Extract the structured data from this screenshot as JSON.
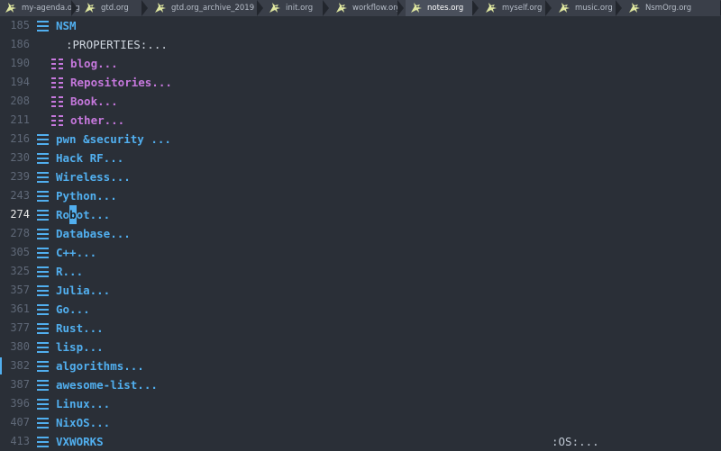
{
  "tabs": [
    {
      "label": "my-agenda.org",
      "active": false
    },
    {
      "label": "gtd.org",
      "active": false
    },
    {
      "label": "gtd.org_archive_2019",
      "active": false
    },
    {
      "label": "init.org",
      "active": false
    },
    {
      "label": "workflow.org",
      "active": false
    },
    {
      "label": "notes.org",
      "active": true
    },
    {
      "label": "myself.org",
      "active": false
    },
    {
      "label": "music.org",
      "active": false
    },
    {
      "label": "NsmOrg.org",
      "active": false
    }
  ],
  "lines": [
    {
      "num": "185",
      "level": 1,
      "text": "NSM"
    },
    {
      "num": "186",
      "level": 0,
      "text": ":PROPERTIES:..."
    },
    {
      "num": "190",
      "level": 2,
      "text": "blog..."
    },
    {
      "num": "194",
      "level": 2,
      "text": "Repositories..."
    },
    {
      "num": "208",
      "level": 2,
      "text": "Book..."
    },
    {
      "num": "211",
      "level": 2,
      "text": "other..."
    },
    {
      "num": "216",
      "level": 1,
      "text": "pwn &security ..."
    },
    {
      "num": "230",
      "level": 1,
      "text": "Hack RF..."
    },
    {
      "num": "239",
      "level": 1,
      "text": "Wireless..."
    },
    {
      "num": "243",
      "level": 1,
      "text": "Python..."
    },
    {
      "num": "274",
      "level": 1,
      "text": "Robot...",
      "current": true,
      "cursor_index": 2
    },
    {
      "num": "278",
      "level": 1,
      "text": "Database..."
    },
    {
      "num": "305",
      "level": 1,
      "text": "C++..."
    },
    {
      "num": "325",
      "level": 1,
      "text": "R..."
    },
    {
      "num": "357",
      "level": 1,
      "text": "Julia..."
    },
    {
      "num": "361",
      "level": 1,
      "text": "Go..."
    },
    {
      "num": "377",
      "level": 1,
      "text": "Rust..."
    },
    {
      "num": "380",
      "level": 1,
      "text": "lisp..."
    },
    {
      "num": "382",
      "level": 1,
      "text": "algorithms...",
      "highlight": true
    },
    {
      "num": "387",
      "level": 1,
      "text": "awesome-list..."
    },
    {
      "num": "396",
      "level": 1,
      "text": "Linux..."
    },
    {
      "num": "407",
      "level": 1,
      "text": "NixOS..."
    },
    {
      "num": "413",
      "level": 1,
      "text": "VXWORKS",
      "trailing": ":OS:..."
    }
  ],
  "colors": {
    "background": "#2a2f37",
    "tabbar": "#3a3f49",
    "heading_level1": "#51afef",
    "heading_level2": "#c678dd",
    "cursor": "#51afef"
  },
  "icons": {
    "tab": "org-unicorn-icon",
    "heading_level1": "list-bars-icon",
    "heading_level2": "dotted-list-icon"
  }
}
